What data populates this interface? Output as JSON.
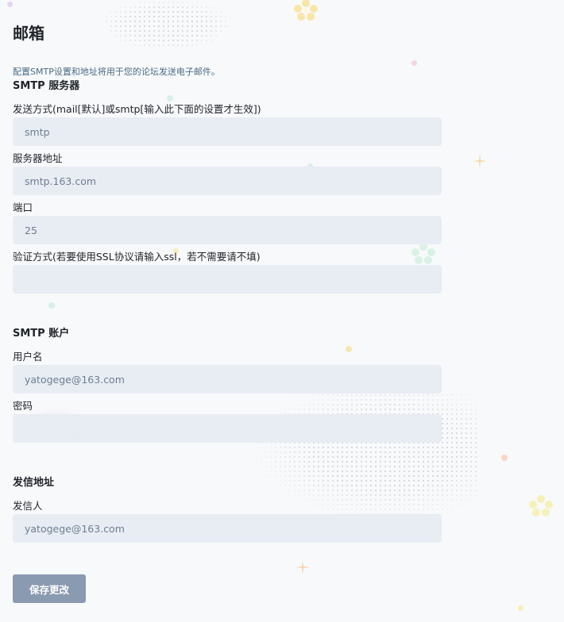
{
  "page": {
    "title": "邮箱",
    "description": "配置SMTP设置和地址将用于您的论坛发送电子邮件。"
  },
  "smtp_server": {
    "section_title": "SMTP 服务器",
    "method": {
      "label": "发送方式(mail[默认]或smtp[输入此下面的设置才生效])",
      "value": "smtp"
    },
    "host": {
      "label": "服务器地址",
      "value": "smtp.163.com"
    },
    "port": {
      "label": "端口",
      "value": "25"
    },
    "encryption": {
      "label": "验证方式(若要使用SSL协议请输入ssl，若不需要请不填)",
      "value": ""
    }
  },
  "smtp_account": {
    "section_title": "SMTP 账户",
    "username": {
      "label": "用户名",
      "value": "yatogege@163.com"
    },
    "password": {
      "label": "密码",
      "value": ""
    }
  },
  "sender": {
    "section_title": "发信地址",
    "from": {
      "label": "发信人",
      "value": "yatogege@163.com"
    }
  },
  "actions": {
    "save_label": "保存更改"
  },
  "colors": {
    "input_bg": "#e8ecf3",
    "button_bg": "#8a9ab0",
    "description_text": "#4b6a86"
  }
}
